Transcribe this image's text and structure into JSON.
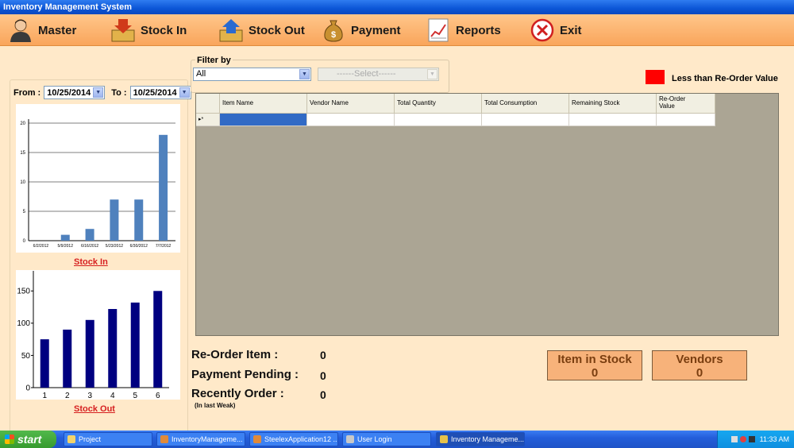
{
  "window": {
    "title": "Inventory Management System"
  },
  "menu": {
    "master": "Master",
    "stock_in": "Stock In",
    "stock_out": "Stock Out",
    "payment": "Payment",
    "reports": "Reports",
    "exit": "Exit"
  },
  "dates": {
    "from_label": "From :",
    "from_value": "10/25/2014",
    "to_label": "To :",
    "to_value": "10/25/2014"
  },
  "filter": {
    "label": "Filter by",
    "primary_value": "All",
    "secondary_value": "------Select------"
  },
  "legend": {
    "text": "Less than Re-Order Value",
    "color": "#ff0000"
  },
  "grid": {
    "columns": [
      "Item Name",
      "Vendor Name",
      "Total Quantity",
      "Total Consumption",
      "Remaining Stock",
      "Re-Order\nValue"
    ],
    "new_row_marker": "▸*"
  },
  "stats": {
    "reorder_label": "Re-Order Item :",
    "reorder_value": "0",
    "payment_label": "Payment Pending :",
    "payment_value": "0",
    "recent_label": "Recently Order :",
    "recent_value": "0",
    "recent_sub": "(In last Weak)"
  },
  "tiles": {
    "stock_title": "Item in Stock",
    "stock_value": "0",
    "vendors_title": "Vendors",
    "vendors_value": "0"
  },
  "links": {
    "stock_in": "Stock In",
    "stock_out": "Stock Out"
  },
  "chart_data": [
    {
      "type": "bar",
      "categories": [
        "6/2/2012",
        "5/9/2012",
        "6/16/2012",
        "5/23/2012",
        "6/30/2012",
        "7/7/2012"
      ],
      "values": [
        0,
        1,
        2,
        7,
        7,
        18
      ],
      "ylim": [
        0,
        20
      ],
      "yticks": [
        0,
        5,
        10,
        15,
        20
      ],
      "grid": true,
      "color": "#4f81bd"
    },
    {
      "type": "bar",
      "categories": [
        "1",
        "2",
        "3",
        "4",
        "5",
        "6"
      ],
      "values": [
        75,
        90,
        105,
        122,
        132,
        150
      ],
      "ylim": [
        0,
        175
      ],
      "yticks": [
        0,
        50,
        100,
        150
      ],
      "grid": false,
      "color": "#000080"
    }
  ],
  "taskbar": {
    "start": "start",
    "items": [
      "Project",
      "InventoryManageme...",
      "SteelexApplication12 ...",
      "User Login",
      "Inventory Manageme..."
    ],
    "clock": "11:33 AM"
  }
}
